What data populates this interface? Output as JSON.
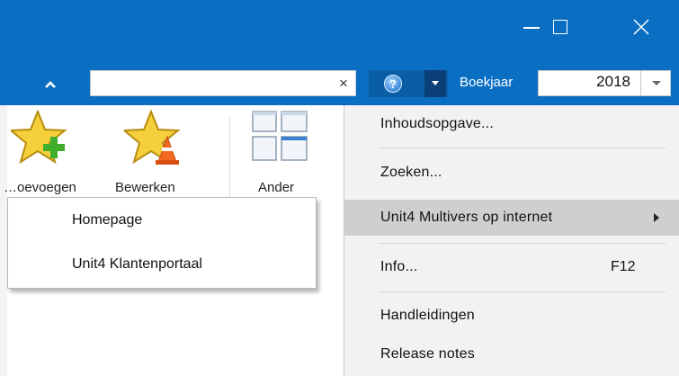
{
  "window": {
    "controls": [
      {
        "icon": "minimize-icon"
      },
      {
        "icon": "maximize-icon"
      },
      {
        "icon": "close-icon"
      }
    ]
  },
  "toolbar": {
    "collapse_icon": "chevron-up-icon",
    "search_value": "",
    "search_clear": "×",
    "help_icon": "help-icon",
    "help_glyph": "?",
    "boekjaar_label": "Boekjaar",
    "boekjaar_value": "2018"
  },
  "ribbon": {
    "buttons": [
      {
        "label": "…oevoegen",
        "icon": "star-plus-icon"
      },
      {
        "label": "Bewerken",
        "icon": "star-edit-icon"
      },
      {
        "label": "Ander",
        "icon": "windows-icon"
      }
    ]
  },
  "help_menu": {
    "items": [
      {
        "label": "Inhoudsopgave...",
        "shortcut": ""
      },
      {
        "label": "Zoeken...",
        "shortcut": ""
      },
      {
        "label": "Unit4 Multivers op internet",
        "shortcut": "",
        "submenu": true,
        "highlighted": true
      },
      {
        "label": "Info...",
        "shortcut": "F12"
      },
      {
        "label": "Handleidingen",
        "shortcut": ""
      },
      {
        "label": "Release notes",
        "shortcut": ""
      }
    ]
  },
  "submenu": {
    "items": [
      {
        "label": "Homepage"
      },
      {
        "label": "Unit4 Klantenportaal"
      }
    ]
  },
  "colors": {
    "titlebar": "#0a6fc2",
    "menu_bg": "#f2f2f2",
    "highlight": "#cfcfcf"
  }
}
